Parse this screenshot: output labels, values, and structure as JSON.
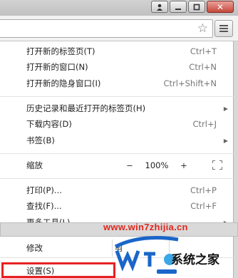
{
  "window": {
    "user_icon": "user-icon",
    "minimize_icon": "minimize-icon",
    "restore_icon": "restore-icon",
    "close_glyph": "✕"
  },
  "toolbar": {
    "star_glyph": "☆",
    "menu_icon": "hamburger-menu-icon"
  },
  "menu": {
    "items": [
      {
        "label": "打开新的标签页(T)",
        "shortcut": "Ctrl+T"
      },
      {
        "label": "打开新的窗口(N)",
        "shortcut": "Ctrl+N"
      },
      {
        "label": "打开新的隐身窗口(I)",
        "shortcut": "Ctrl+Shift+N"
      },
      {
        "label": "历史记录和最近打开的标签页(H)",
        "arrow": "▶"
      },
      {
        "label": "下载内容(D)",
        "shortcut": "Ctrl+J"
      },
      {
        "label": "书签(B)",
        "arrow": "▶"
      },
      {
        "label": "打印(P)...",
        "shortcut": "Ctrl+P"
      },
      {
        "label": "查找(F)...",
        "shortcut": "Ctrl+F"
      },
      {
        "label": "更多工具(L)",
        "arrow": "▶"
      }
    ],
    "zoom": {
      "label": "缩放",
      "minus": "−",
      "value": "100%",
      "plus": "+"
    },
    "edit": {
      "label": "修改",
      "cut_partial": "剪"
    },
    "settings": {
      "label": "设置(S)"
    }
  },
  "watermark": {
    "url": "www.win7zhijia.cn",
    "brand": "系统之家",
    "colors": {
      "red": "#e0261c",
      "blue": "#1a66c9"
    }
  },
  "highlight_color": "#e62121"
}
